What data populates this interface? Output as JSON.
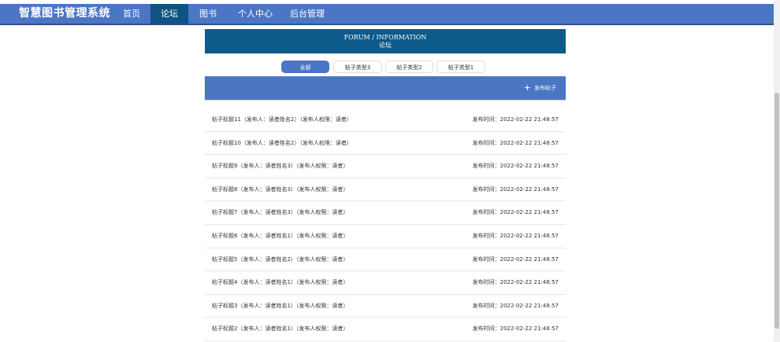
{
  "nav": {
    "brand": "智慧图书管理系统",
    "items": [
      {
        "label": "首页"
      },
      {
        "label": "论坛"
      },
      {
        "label": "图书"
      },
      {
        "label": "个人中心"
      },
      {
        "label": "后台管理"
      }
    ],
    "active_index": 1
  },
  "hero": {
    "title_en": "FORUM / INFORMATION",
    "title_cn": "论坛"
  },
  "filters": [
    {
      "label": "全部"
    },
    {
      "label": "帖子类型3"
    },
    {
      "label": "帖子类型2"
    },
    {
      "label": "帖子类型1"
    }
  ],
  "active_filter": 0,
  "actions": {
    "publish_label": "发布帖子"
  },
  "posts": [
    {
      "title": "帖子标题11（发布人：读者姓名2）（发布人权限：读者）",
      "time": "发布时间：2022-02-22 21:48:57"
    },
    {
      "title": "帖子标题10（发布人：读者姓名2）（发布人权限：读者）",
      "time": "发布时间：2022-02-22 21:48:57"
    },
    {
      "title": "帖子标题9（发布人：读者姓名3）（发布人权限：读者）",
      "time": "发布时间：2022-02-22 21:48:57"
    },
    {
      "title": "帖子标题8（发布人：读者姓名3）（发布人权限：读者）",
      "time": "发布时间：2022-02-22 21:48:57"
    },
    {
      "title": "帖子标题7（发布人：读者姓名3）（发布人权限：读者）",
      "time": "发布时间：2022-02-22 21:48:57"
    },
    {
      "title": "帖子标题6（发布人：读者姓名1）（发布人权限：读者）",
      "time": "发布时间：2022-02-22 21:48:57"
    },
    {
      "title": "帖子标题5（发布人：读者姓名2）（发布人权限：读者）",
      "time": "发布时间：2022-02-22 21:48:57"
    },
    {
      "title": "帖子标题4（发布人：读者姓名1）（发布人权限：读者）",
      "time": "发布时间：2022-02-22 21:48:57"
    },
    {
      "title": "帖子标题3（发布人：读者姓名1）（发布人权限：读者）",
      "time": "发布时间：2022-02-22 21:48:57"
    },
    {
      "title": "帖子标题2（发布人：读者姓名1）（发布人权限：读者）",
      "time": "发布时间：2022-02-22 21:48:57"
    }
  ],
  "colors": {
    "nav_bg": "#4a76c4",
    "nav_active": "#0e5383",
    "hero_bg": "#0e5a8a",
    "accent": "#4a76c4"
  }
}
